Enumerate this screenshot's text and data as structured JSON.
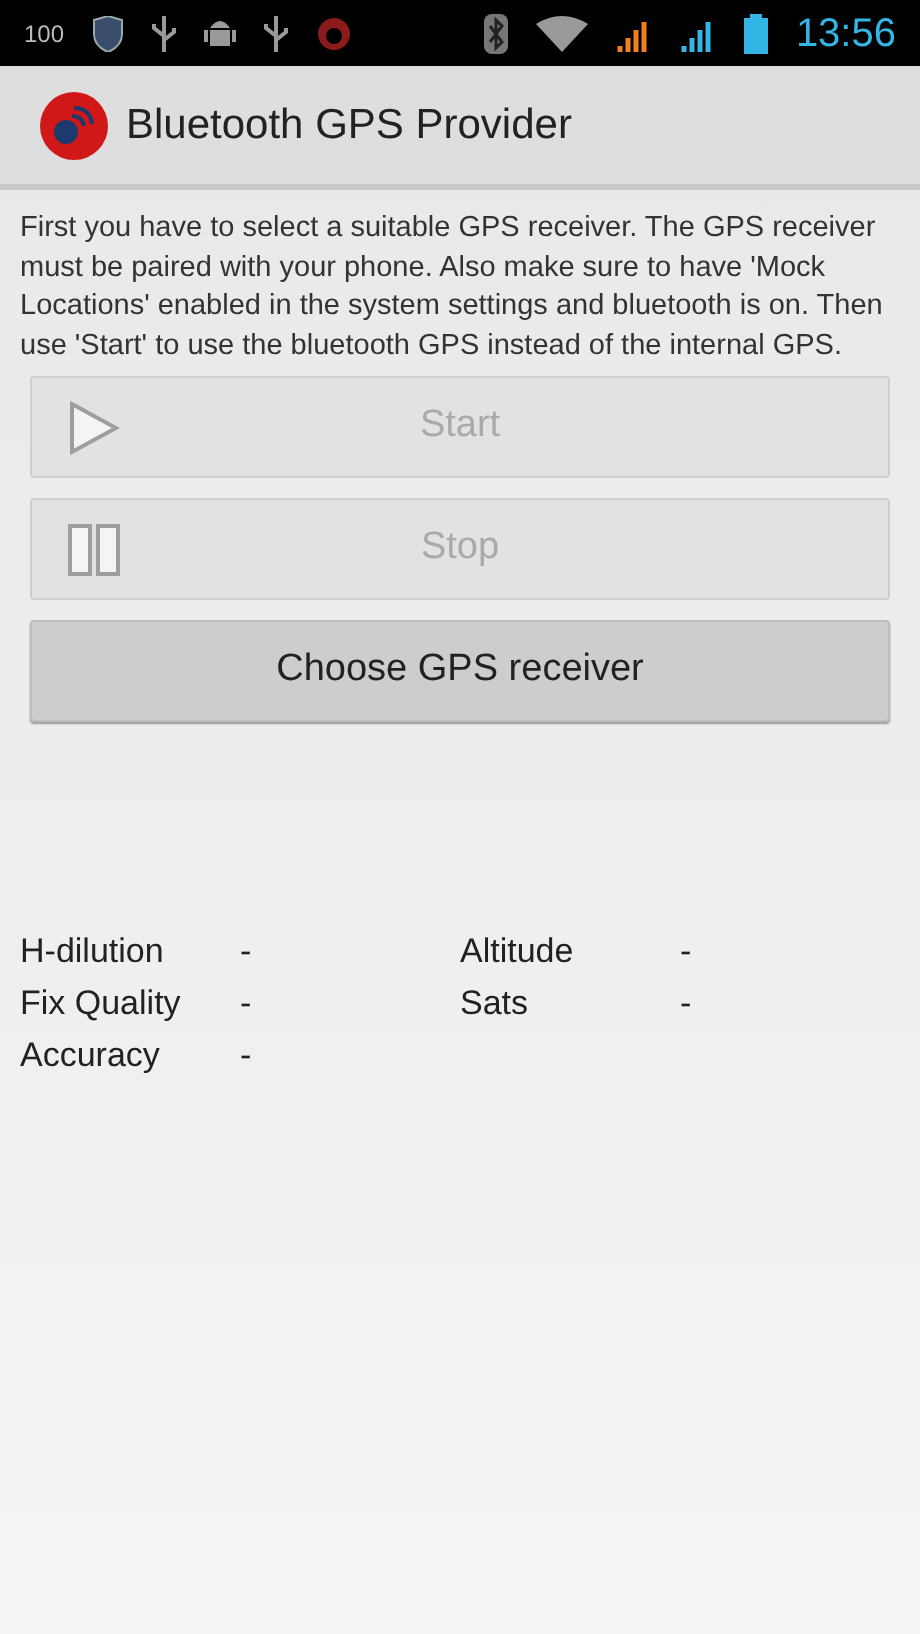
{
  "status_bar": {
    "battery_percent": "100",
    "time": "13:56"
  },
  "action_bar": {
    "title": "Bluetooth GPS Provider"
  },
  "description": "First you have to select a suitable GPS receiver. The GPS receiver must be paired with your phone. Also make sure to have 'Mock Locations' enabled in the system settings and bluetooth is on. Then use 'Start' to use the bluetooth GPS instead of the internal GPS.",
  "buttons": [
    {
      "label": "Start",
      "kind": "play",
      "disabled": true
    },
    {
      "label": "Stop",
      "kind": "pause",
      "disabled": true
    },
    {
      "label": "Choose GPS receiver",
      "kind": "plain",
      "disabled": false
    }
  ],
  "stats": [
    {
      "label": "H-dilution",
      "value": "-"
    },
    {
      "label": "Altitude",
      "value": "-"
    },
    {
      "label": "Fix Quality",
      "value": "-"
    },
    {
      "label": "Sats",
      "value": "-"
    },
    {
      "label": "Accuracy",
      "value": "-"
    }
  ]
}
